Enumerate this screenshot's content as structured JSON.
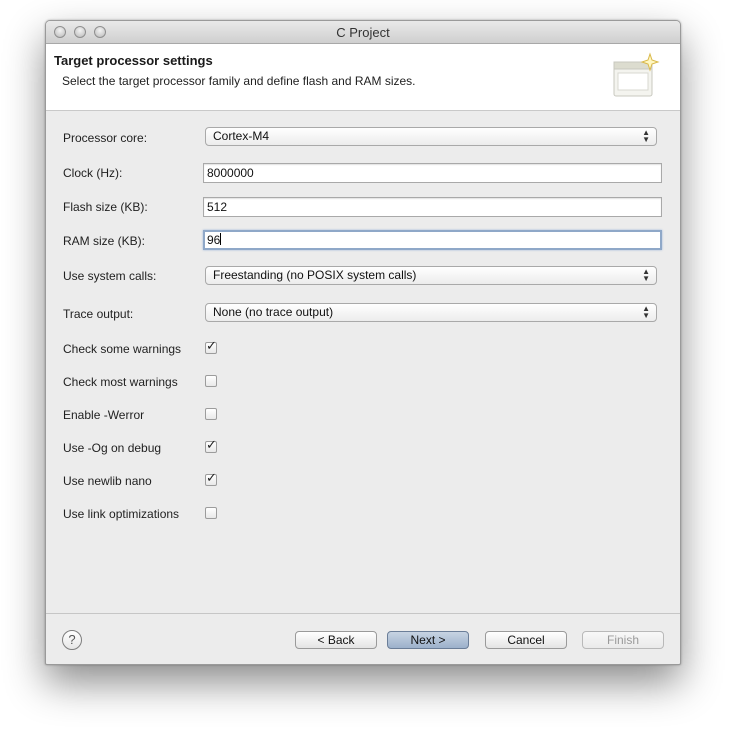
{
  "window": {
    "title": "C Project"
  },
  "banner": {
    "title": "Target processor settings",
    "description": "Select the target processor family and define flash and RAM sizes."
  },
  "form": {
    "processor_core": {
      "label": "Processor core:",
      "value": "Cortex-M4"
    },
    "clock": {
      "label": "Clock (Hz):",
      "value": "8000000"
    },
    "flash_size": {
      "label": "Flash size (KB):",
      "value": "512"
    },
    "ram_size": {
      "label": "RAM size (KB):",
      "value": "96"
    },
    "system_calls": {
      "label": "Use system calls:",
      "value": "Freestanding (no POSIX system calls)"
    },
    "trace_output": {
      "label": "Trace output:",
      "value": "None (no trace output)"
    },
    "check_some_warnings": {
      "label": "Check some warnings",
      "checked": true
    },
    "check_most_warnings": {
      "label": "Check most warnings",
      "checked": false
    },
    "enable_werror": {
      "label": "Enable -Werror",
      "checked": false
    },
    "use_og_on_debug": {
      "label": "Use -Og on debug",
      "checked": true
    },
    "use_newlib_nano": {
      "label": "Use newlib nano",
      "checked": true
    },
    "use_link_optimizations": {
      "label": "Use link optimizations",
      "checked": false
    }
  },
  "footer": {
    "help_glyph": "?",
    "back_label": "< Back",
    "next_label": "Next >",
    "cancel_label": "Cancel",
    "finish_label": "Finish"
  },
  "icons": {
    "select_arrows": "updown-arrows-icon",
    "check_mark": "checkmark-icon"
  },
  "colors": {
    "default_button": "#a9bbd2",
    "focus_ring": "#8fa8c8",
    "dialog_background": "#ececec"
  }
}
